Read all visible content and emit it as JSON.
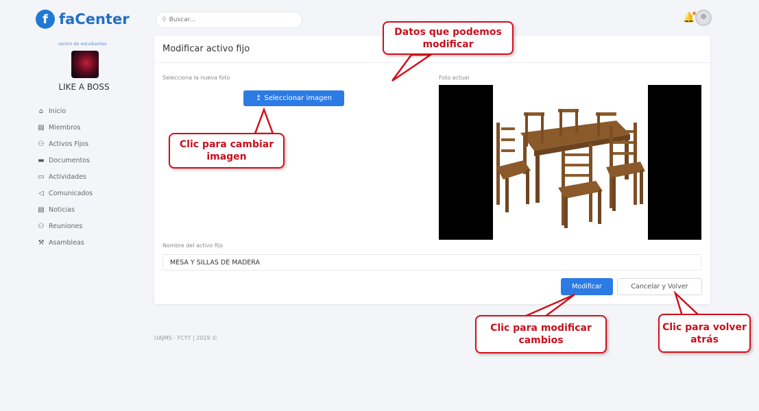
{
  "brand": {
    "logo_letter": "f",
    "name": "faCenter"
  },
  "organization": {
    "subtitle": "centro de estudiantes",
    "name": "LIKE A BOSS"
  },
  "sidebar": {
    "items": [
      {
        "icon": "home-icon",
        "glyph": "⌂",
        "label": "Inicio"
      },
      {
        "icon": "id-card-icon",
        "glyph": "▤",
        "label": "Miembros"
      },
      {
        "icon": "users-icon",
        "glyph": "⚇",
        "label": "Activos Fijos"
      },
      {
        "icon": "folder-icon",
        "glyph": "▬",
        "label": "Documentos"
      },
      {
        "icon": "calendar-icon",
        "glyph": "▭",
        "label": "Actividades"
      },
      {
        "icon": "megaphone-icon",
        "glyph": "◁",
        "label": "Comunicados"
      },
      {
        "icon": "newspaper-icon",
        "glyph": "▤",
        "label": "Noticias"
      },
      {
        "icon": "meeting-icon",
        "glyph": "⚇",
        "label": "Reuniones"
      },
      {
        "icon": "gavel-icon",
        "glyph": "⚒",
        "label": "Asambleas"
      }
    ]
  },
  "search": {
    "placeholder": "Buscar..."
  },
  "card": {
    "title": "Modificar activo fijo",
    "new_photo_label": "Selecciona la nueva foto",
    "upload_button": "Seleccionar imagen",
    "current_photo_label": "Foto actual",
    "name_label": "Nombre del activo fijo",
    "name_value": "MESA Y SILLAS DE MADERA",
    "modify_button": "Modificar",
    "cancel_button": "Cancelar y Volver"
  },
  "footer": {
    "text": "UAJMS - FCYT | 2019 ©"
  },
  "callouts": {
    "datos": "Datos que podemos modificar",
    "cambiar": "Clic para cambiar imagen",
    "modificar": "Clic para modificar cambios",
    "volver": "Clic para volver atrás"
  },
  "colors": {
    "accent": "#2c7be5",
    "callout_red": "#d10f1a",
    "brand": "#1f6fc7"
  }
}
